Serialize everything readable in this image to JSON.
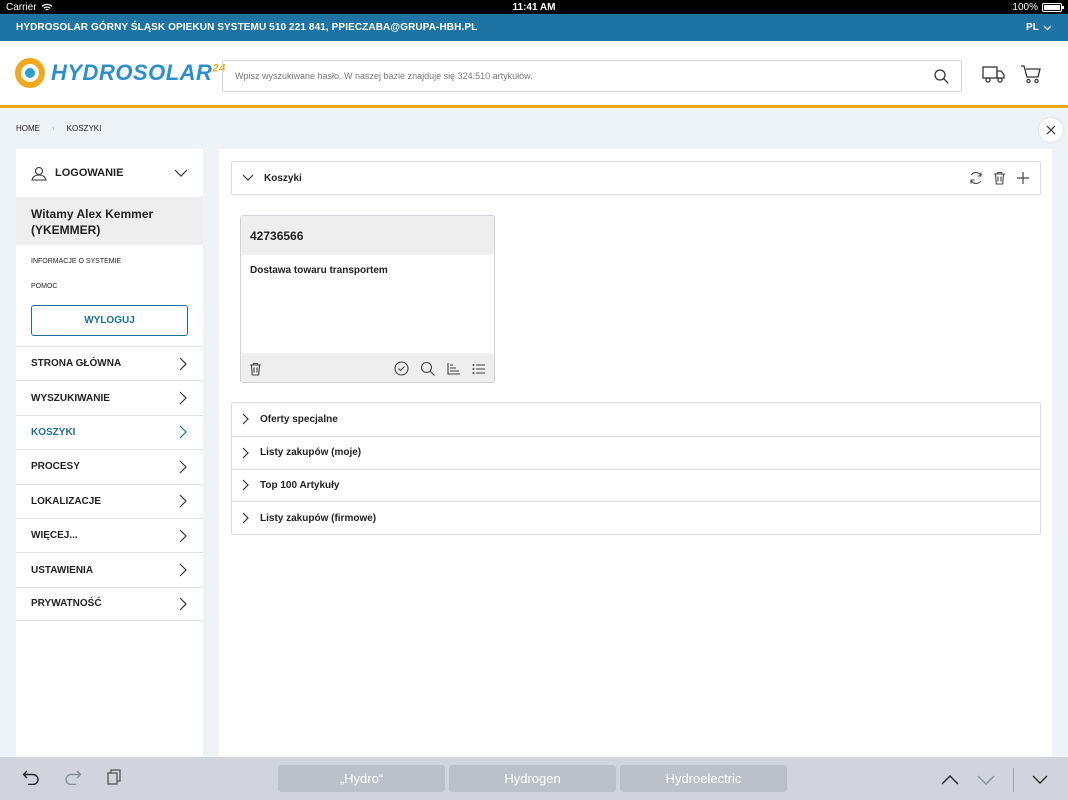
{
  "status_bar": {
    "carrier": "Carrier",
    "time": "11:41 AM",
    "battery": "100%"
  },
  "info_bar": {
    "text": "HYDROSOLAR GÓRNY ŚLĄSK OPIEKUN SYSTEMU 510 221 841, PPIECZABA@GRUPA-HBH.PL",
    "language": "PL"
  },
  "header": {
    "logo_text": "HYDROSOLAR",
    "logo_suffix": "24",
    "search_placeholder": "Wpisz wyszukiwane hasło. W naszej bazie znajduje się 324.510 artykułów."
  },
  "breadcrumb": {
    "home": "HOME",
    "current": "KOSZYKI"
  },
  "sidebar": {
    "login_label": "LOGOWANIE",
    "welcome": "Witamy Alex Kemmer (YKEMMER)",
    "system_info": "INFORMACJE O SYSTEMIE",
    "help": "POMOC",
    "logout": "WYLOGUJ",
    "items": [
      {
        "label": "STRONA GŁÓWNA"
      },
      {
        "label": "WYSZUKIWANIE"
      },
      {
        "label": "KOSZYKI"
      },
      {
        "label": "PROCESY"
      },
      {
        "label": "LOKALIZACJE"
      },
      {
        "label": "WIĘCEJ..."
      },
      {
        "label": "USTAWIENIA"
      },
      {
        "label": "PRYWATNOŚĆ"
      }
    ]
  },
  "main": {
    "panel_title": "Koszyki",
    "cart": {
      "number": "42736566",
      "description": "Dostawa towaru transportem"
    },
    "accordion": [
      {
        "label": "Oferty specjalne"
      },
      {
        "label": "Listy zakupów (moje)"
      },
      {
        "label": "Top 100 Artykuły"
      },
      {
        "label": "Listy zakupów (firmowe)"
      }
    ]
  },
  "keyboard": {
    "suggestions": [
      "„Hydro“",
      "Hydrogen",
      "Hydroelectric"
    ]
  },
  "colors": {
    "brand_blue": "#1c73a4",
    "accent_orange": "#f0a818",
    "active_nav": "#1a6d9c"
  }
}
